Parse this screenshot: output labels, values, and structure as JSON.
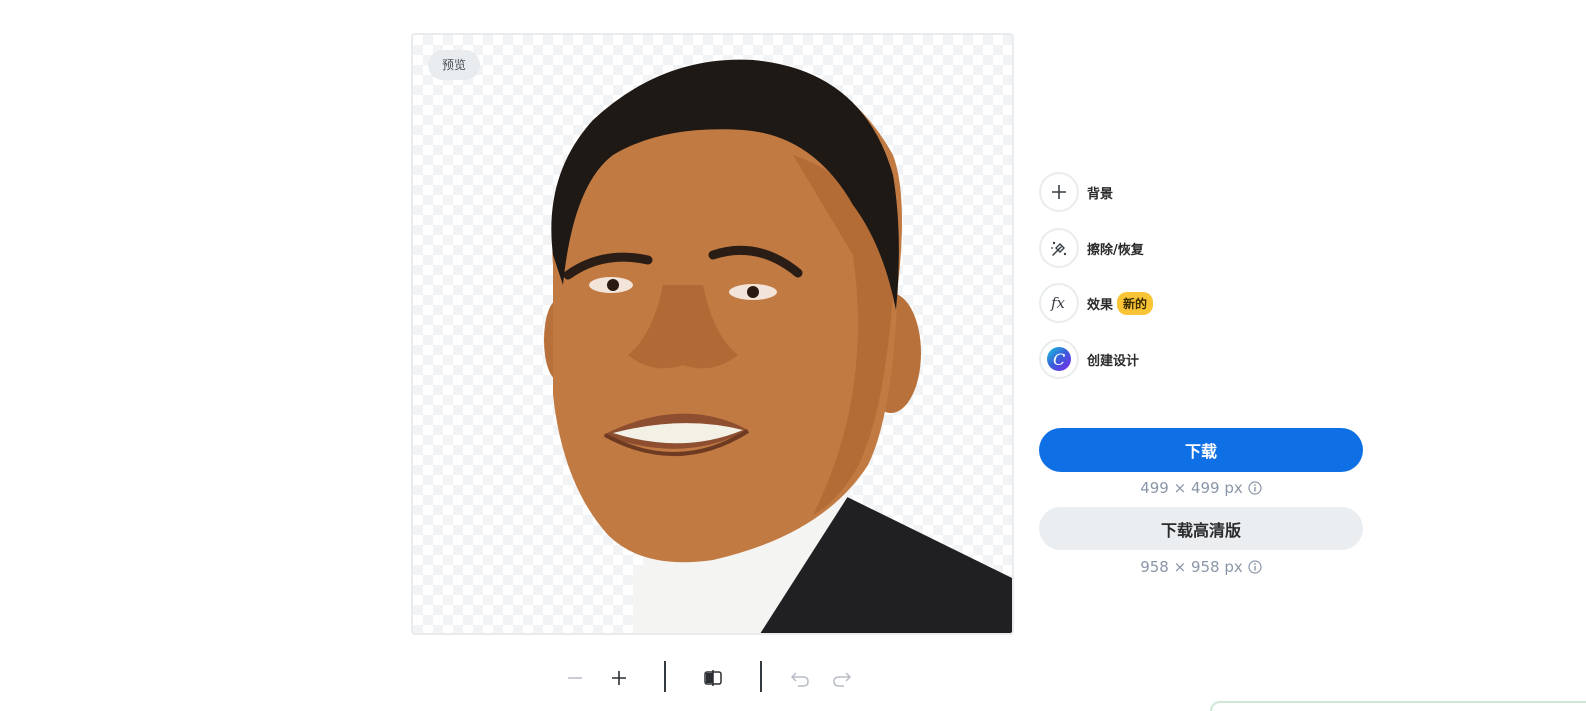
{
  "preview": {
    "badge": "预览"
  },
  "tools": [
    {
      "label": "背景",
      "icon": "plus-icon"
    },
    {
      "label": "擦除/恢复",
      "icon": "magic-brush-icon"
    },
    {
      "label": "效果",
      "icon": "fx-icon",
      "badge": "新的"
    },
    {
      "label": "创建设计",
      "icon": "canva-logo-icon"
    }
  ],
  "download": {
    "label": "下载",
    "size": "499 × 499 px",
    "hd_label": "下载高清版",
    "hd_size": "958 × 958 px"
  },
  "colors": {
    "primary": "#0f70e6",
    "badge_new": "#f9c436",
    "secondary_button": "#ebeef1"
  },
  "toolbar": [
    "zoom-out-icon",
    "zoom-in-icon",
    "compare-icon",
    "undo-icon",
    "redo-icon"
  ]
}
